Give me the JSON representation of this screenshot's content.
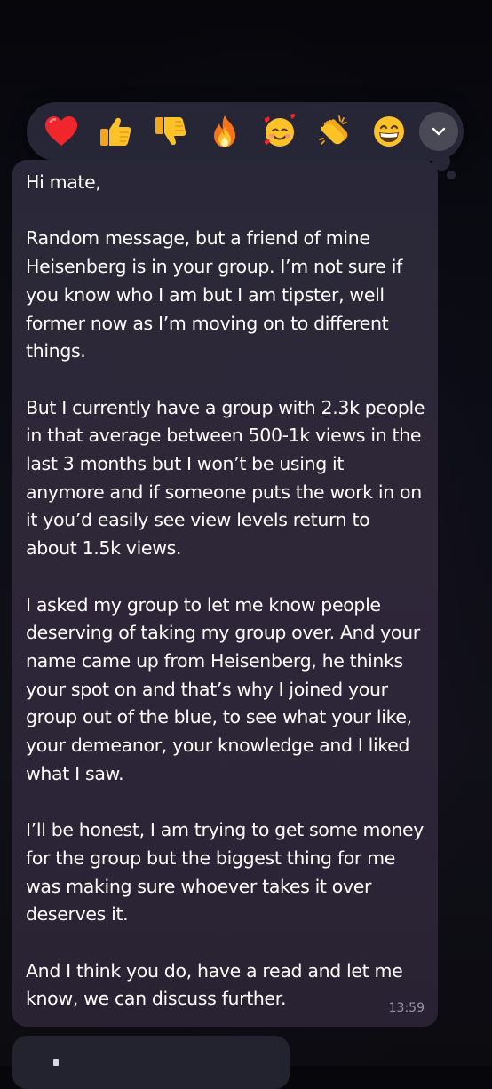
{
  "reactions": [
    {
      "name": "red-heart",
      "emoji": "❤️"
    },
    {
      "name": "thumbs-up",
      "emoji": "👍"
    },
    {
      "name": "thumbs-down",
      "emoji": "👎"
    },
    {
      "name": "fire",
      "emoji": "🔥"
    },
    {
      "name": "smiling-face-with-hearts",
      "emoji": "🥰"
    },
    {
      "name": "clapping-hands",
      "emoji": "👏"
    },
    {
      "name": "grinning-face",
      "emoji": "😁"
    }
  ],
  "reaction_bar": {
    "expand_icon": "chevron-down-icon"
  },
  "message": {
    "text": "Hi mate,\n\nRandom message, but a friend of mine Heisenberg is in your group. I’m not sure if you know who I am but I am tipster, well former now as I’m moving on to different things.\n\nBut I currently have a group with 2.3k people in that average between 500-1k views in the last 3 months but I won’t be using it anymore and if someone puts the work in on it you’d easily see view levels return to about 1.5k views.\n\nI asked my group to let me know people deserving of taking my group over. And your name came up from Heisenberg, he thinks your spot on and that’s why I joined your group out of the blue, to see what your like, your demeanor, your knowledge and I liked what I saw.\n\nI’ll be honest, I am trying to get some money for the group but the biggest thing for me was making sure whoever takes it over deserves it.\n\nAnd I think you do, have a read and let me know, we can discuss further.",
    "time": "13:59"
  },
  "colors": {
    "background": "#0b0b12",
    "bubble": "#2c2637",
    "reaction_bar": "#262636",
    "timestamp": "#9a95a8"
  }
}
